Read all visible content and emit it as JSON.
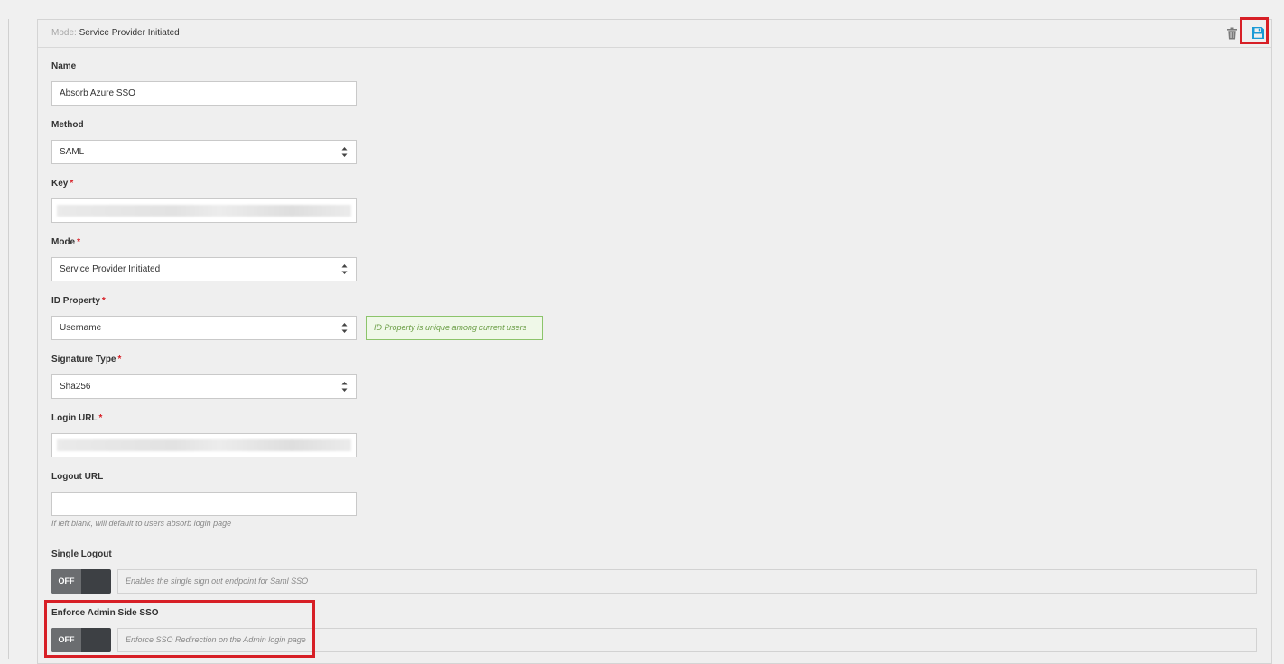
{
  "header": {
    "mode_label": "Mode:",
    "mode_value": "Service Provider Initiated"
  },
  "icons": {
    "trash": "trash-icon",
    "save": "floppy-disk-save-icon",
    "save_color": "#1a9ad6",
    "highlight_color": "#d71f26"
  },
  "form": {
    "name": {
      "label": "Name",
      "value": "Absorb Azure SSO"
    },
    "method": {
      "label": "Method",
      "value": "SAML"
    },
    "key": {
      "label": "Key",
      "required": "*"
    },
    "mode": {
      "label": "Mode",
      "required": "*",
      "value": "Service Provider Initiated"
    },
    "id_property": {
      "label": "ID Property",
      "required": "*",
      "value": "Username",
      "hint": "ID Property is unique among current users"
    },
    "signature_type": {
      "label": "Signature Type",
      "required": "*",
      "value": "Sha256"
    },
    "login_url": {
      "label": "Login URL",
      "required": "*"
    },
    "logout_url": {
      "label": "Logout URL",
      "value": "",
      "help": "If left blank, will default to users absorb login page"
    },
    "single_logout": {
      "label": "Single Logout",
      "state": "OFF",
      "description": "Enables the single sign out endpoint for Saml SSO"
    },
    "enforce_admin_sso": {
      "label": "Enforce Admin Side SSO",
      "state": "OFF",
      "description": "Enforce SSO Redirection on the Admin login page"
    }
  }
}
